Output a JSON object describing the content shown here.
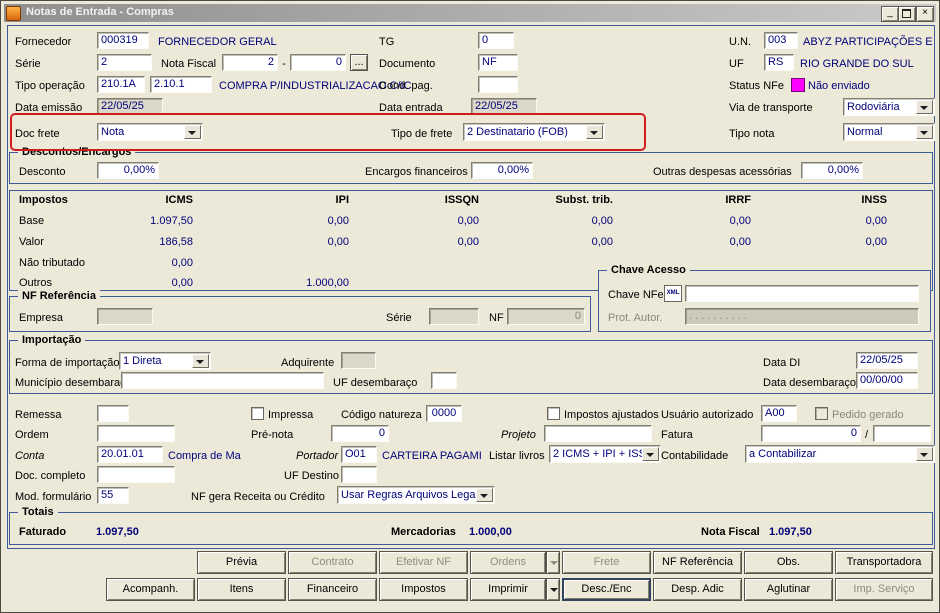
{
  "window": {
    "title": "Notas de Entrada - Compras"
  },
  "icons": {
    "minimize": "_",
    "close": "×",
    "browse": "...",
    "xml": "XML"
  },
  "colors": {
    "highlight_red": "#cf1d1d",
    "status_nfe_magenta": "#ff00ff",
    "value_navy": "#00007b",
    "group_border_blue": "#3e5a99"
  },
  "top": {
    "fornecedor_label": "Fornecedor",
    "fornecedor_code": "000319",
    "fornecedor_name": "FORNECEDOR GERAL",
    "tg_label": "TG",
    "tg_value": "0",
    "un_label": "U.N.",
    "un_code": "003",
    "un_name": "ABYZ PARTICIPAÇÕES E",
    "serie_label": "Série",
    "serie_value": "2",
    "nota_fiscal_label": "Nota Fiscal",
    "nota_fiscal_value": "2",
    "nota_fiscal_sep": "-",
    "nota_fiscal_value2": "0",
    "documento_label": "Documento",
    "documento_value": "NF",
    "uf_label": "UF",
    "uf_code": "RS",
    "uf_name": "RIO GRANDE DO SUL",
    "tipo_operacao_label": "Tipo operação",
    "tipo_operacao_code1": "210.1A",
    "tipo_operacao_code2": "2.10.1",
    "tipo_operacao_desc": "COMPRA P/INDUSTRIALIZACAO C/IC",
    "cond_pag_label": "Cond. pag.",
    "status_nfe_label": "Status NFe",
    "status_nfe_value": "Não enviado",
    "data_emissao_label": "Data emissão",
    "data_emissao_value": "22/05/25",
    "data_entrada_label": "Data entrada",
    "data_entrada_value": "22/05/25",
    "via_transporte_label": "Via de transporte",
    "via_transporte_value": "Rodoviária",
    "doc_frete_label": "Doc frete",
    "doc_frete_value": "Nota",
    "tipo_frete_label": "Tipo de frete",
    "tipo_frete_value": "2 Destinatario (FOB)",
    "tipo_nota_label": "Tipo nota",
    "tipo_nota_value": "Normal"
  },
  "descontos": {
    "title": "Descontos/Encargos",
    "desconto_label": "Desconto",
    "desconto_value": "0,00%",
    "encargos_label": "Encargos financeiros",
    "encargos_value": "0,00%",
    "outras_label": "Outras despesas acessórias",
    "outras_value": "0,00%"
  },
  "impostos": {
    "title": "Impostos",
    "columns": [
      "ICMS",
      "IPI",
      "ISSQN",
      "Subst. trib.",
      "IRRF",
      "INSS"
    ],
    "rows": [
      {
        "label": "Base",
        "values": [
          "1.097,50",
          "0,00",
          "0,00",
          "0,00",
          "0,00",
          "0,00"
        ]
      },
      {
        "label": "Valor",
        "values": [
          "186,58",
          "0,00",
          "0,00",
          "0,00",
          "0,00",
          "0,00"
        ]
      },
      {
        "label": "Não tributado",
        "values": [
          "0,00",
          "",
          "",
          "",
          "",
          ""
        ]
      },
      {
        "label": "Outros",
        "values": [
          "0,00",
          "1.000,00",
          "",
          "",
          "",
          ""
        ]
      }
    ]
  },
  "chave": {
    "title": "Chave Acesso",
    "chave_nfe_label": "Chave NFe",
    "prot_label": "Prot. Autor.",
    "prot_value": ".  .  .  .  .  .  .  .  .  ."
  },
  "nfref": {
    "title": "NF Referência",
    "empresa_label": "Empresa",
    "serie_label": "Série",
    "nf_label": "NF",
    "nf_value": "0"
  },
  "importacao": {
    "title": "Importação",
    "forma_label": "Forma de importação",
    "forma_value": "1 Direta",
    "adquirente_label": "Adquirente",
    "data_di_label": "Data DI",
    "data_di_value": "22/05/25",
    "municipio_label": "Município desembaraço",
    "uf_label": "UF desembaraço",
    "data_des_label": "Data desembaraço",
    "data_des_value": "00/00/00"
  },
  "campos": {
    "remessa_label": "Remessa",
    "impressa_label": "Impressa",
    "cod_natureza_label": "Código natureza",
    "cod_natureza_value": "0000",
    "impostos_ajustados_label": "Impostos ajustados",
    "usuario_label": "Usuário autorizado",
    "usuario_value": "A00",
    "pedido_gerado_label": "Pedido gerado",
    "ordem_label": "Ordem",
    "pre_nota_label": "Pré-nota",
    "pre_nota_value": "0",
    "projeto_label": "Projeto",
    "fatura_label": "Fatura",
    "fatura_value": "0",
    "fatura_sep": "/",
    "conta_label": "Conta",
    "conta_value": "20.01.01",
    "conta_desc": "Compra de Ma",
    "portador_label": "Portador",
    "portador_value": "O01",
    "portador_desc": "CARTEIRA PAGAMI",
    "listar_livros_label": "Listar livros",
    "listar_livros_value": "2 ICMS + IPI + ISS",
    "contabilidade_label": "Contabilidade",
    "contabilidade_value": "a Contabilizar",
    "doc_completo_label": "Doc. completo",
    "uf_destino_label": "UF Destino",
    "mod_formulario_label": "Mod. formulário",
    "mod_formulario_value": "55",
    "nf_gera_label": "NF gera Receita ou Crédito",
    "nf_gera_value": "Usar Regras Arquivos Legais"
  },
  "totais": {
    "title": "Totais",
    "faturado_label": "Faturado",
    "faturado_value": "1.097,50",
    "mercadorias_label": "Mercadorias",
    "mercadorias_value": "1.000,00",
    "nota_fiscal_label": "Nota Fiscal",
    "nota_fiscal_value": "1.097,50"
  },
  "buttons": {
    "row1": [
      {
        "label": "Prévia",
        "disabled": false
      },
      {
        "label": "Contrato",
        "disabled": true
      },
      {
        "label": "Efetivar NF",
        "disabled": true
      },
      {
        "label": "Ordens",
        "disabled": true
      },
      {
        "label": "Frete",
        "disabled": true
      },
      {
        "label": "NF Referência",
        "disabled": false
      },
      {
        "label": "Obs.",
        "disabled": false
      },
      {
        "label": "Transportadora",
        "disabled": false
      }
    ],
    "row2": [
      {
        "label": "Acompanh.",
        "disabled": false
      },
      {
        "label": "Itens",
        "disabled": false
      },
      {
        "label": "Financeiro",
        "disabled": false
      },
      {
        "label": "Impostos",
        "disabled": false
      },
      {
        "label": "Imprimir",
        "disabled": false
      },
      {
        "label": "Desc./Enc",
        "disabled": false
      },
      {
        "label": "Desp. Adic",
        "disabled": false
      },
      {
        "label": "Aglutinar",
        "disabled": false
      },
      {
        "label": "Imp. Serviço",
        "disabled": true
      }
    ]
  }
}
